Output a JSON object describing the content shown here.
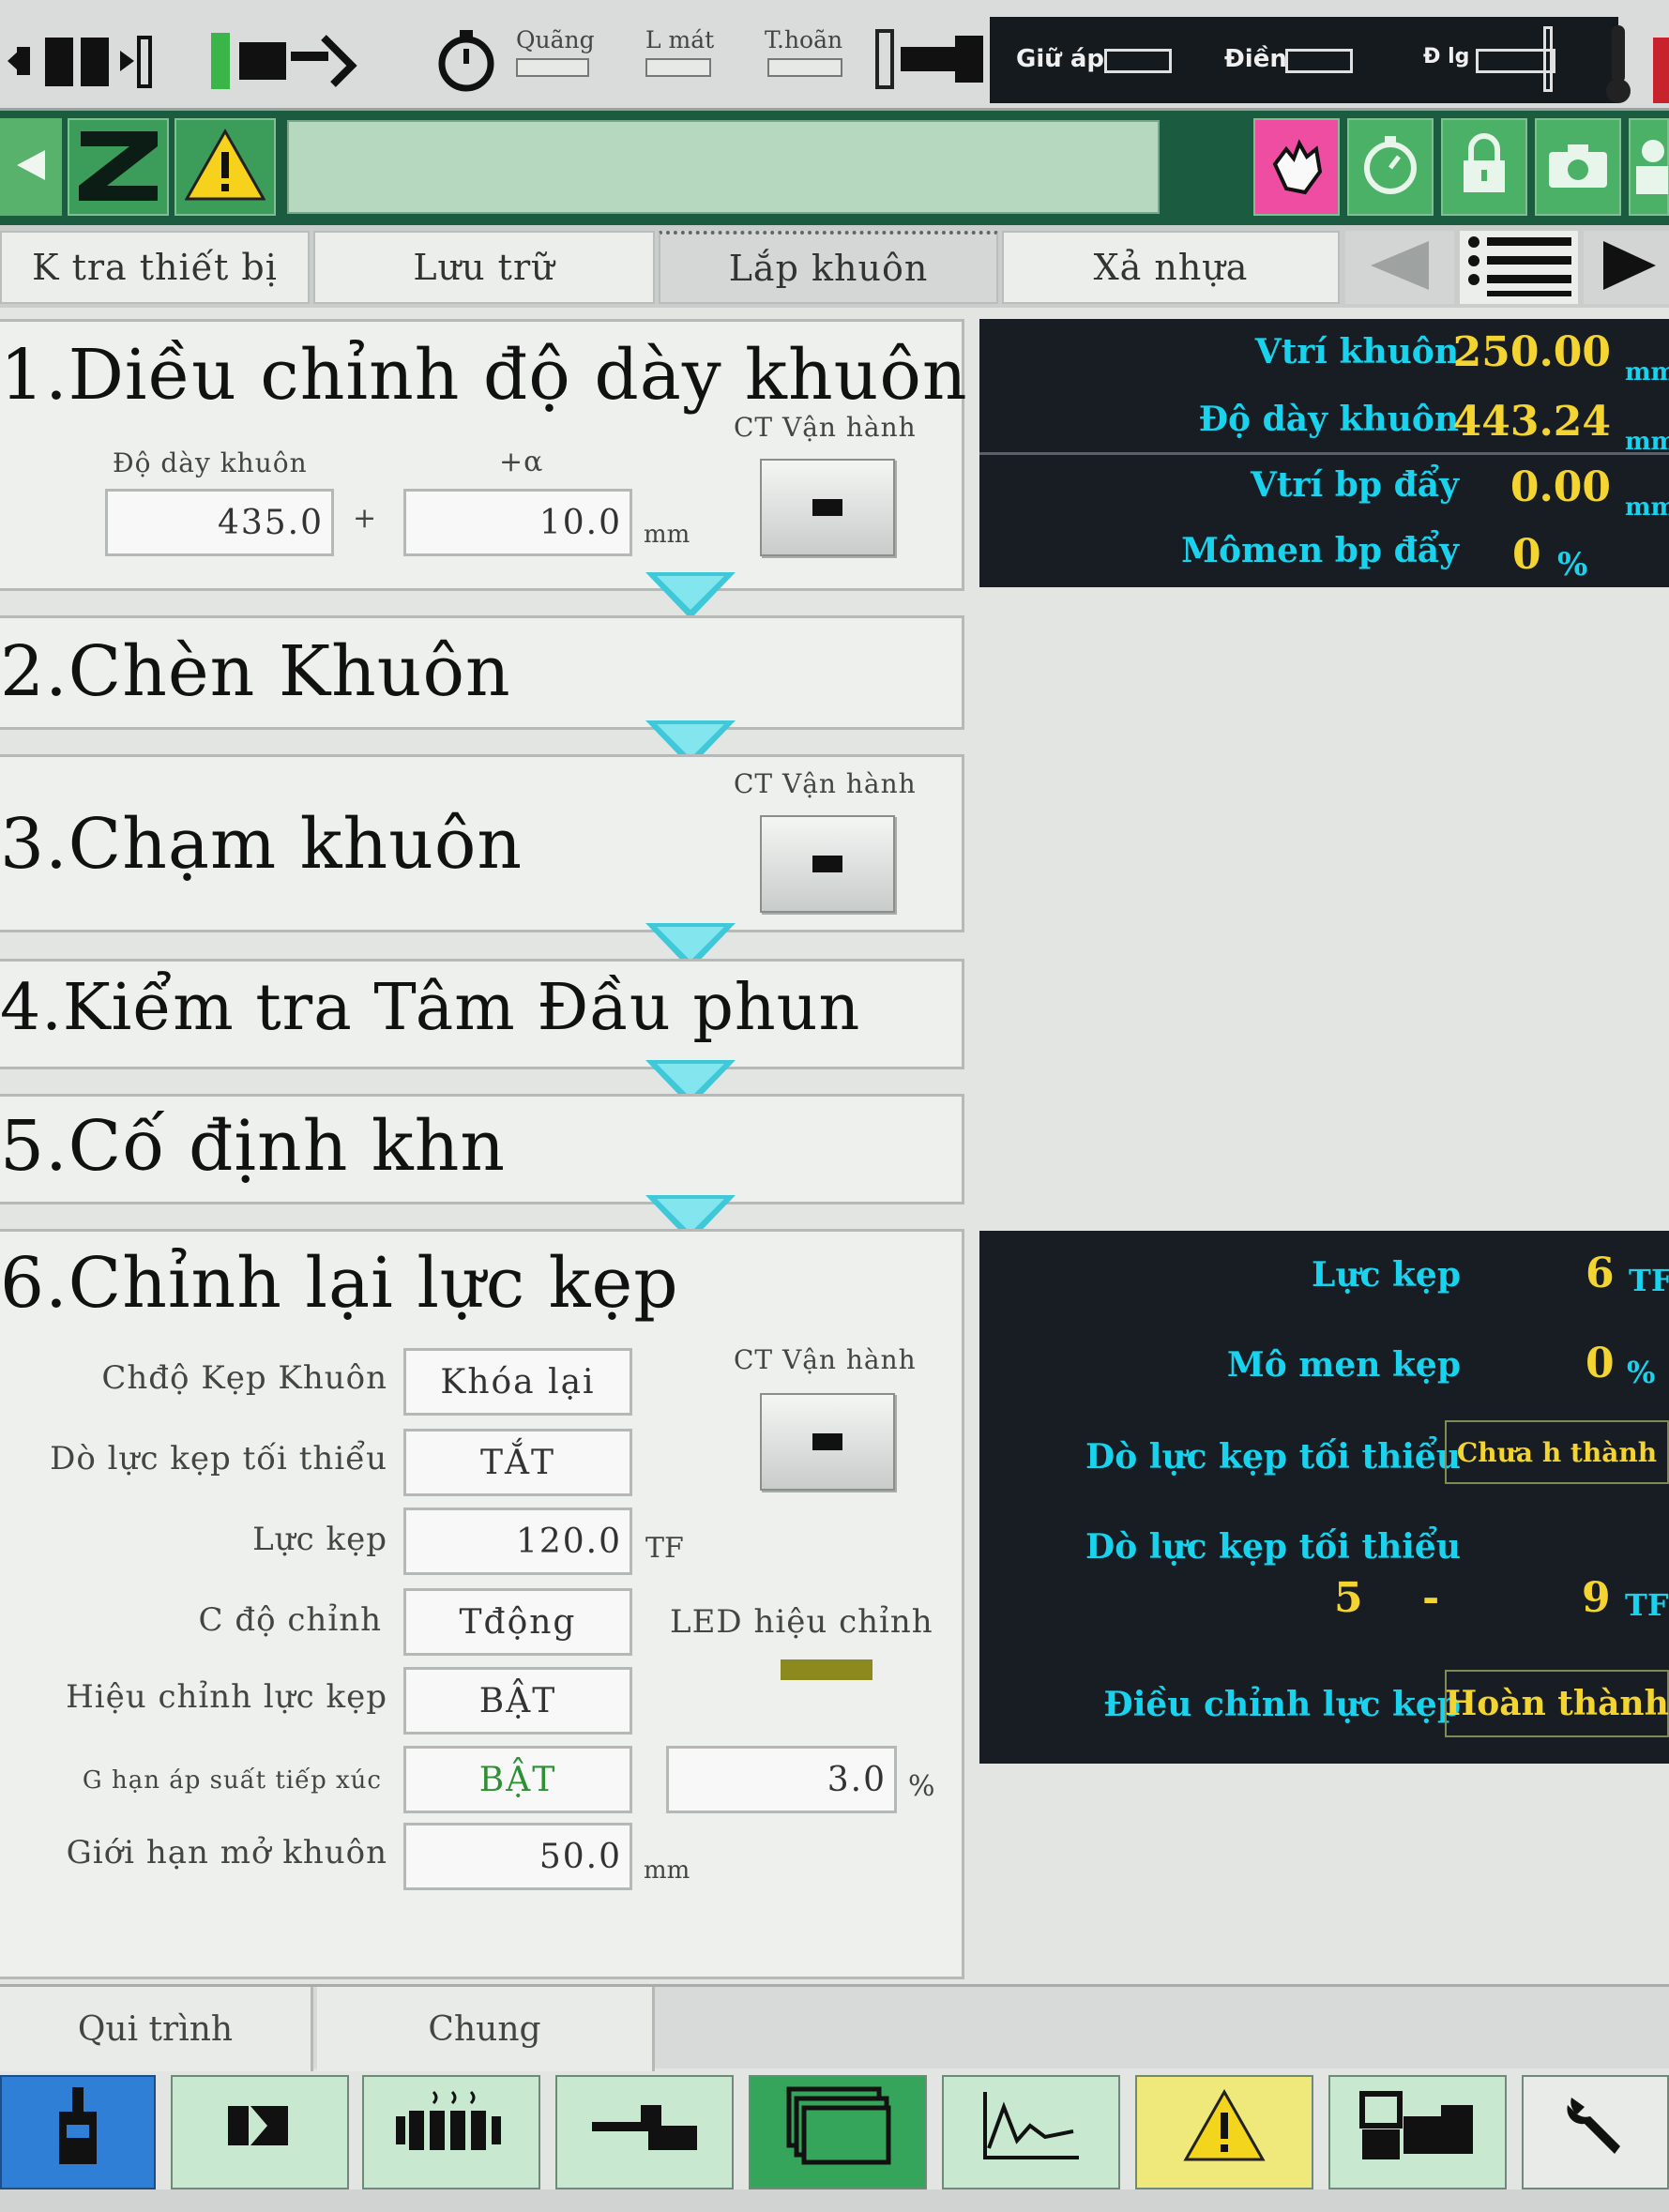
{
  "topbar": {
    "icons": [
      "mold-open-icon",
      "ejector-icon",
      "timer-icon"
    ],
    "labels": {
      "quang": "Quãng",
      "lmat": "L mát",
      "thoan": "T.hoãn"
    },
    "dark": {
      "giu_ap": "Giữ áp",
      "dien": "Điền",
      "dlg": "Đ lg"
    }
  },
  "bar2": {
    "icons": [
      "arrow-left-icon",
      "z-logo-icon",
      "warning-icon",
      "hand-icon",
      "stopwatch-icon",
      "lock-icon",
      "camera-icon",
      "user-icon"
    ]
  },
  "tabs": [
    "K tra thiết bị",
    "Lưu trữ",
    "Lắp khuôn",
    "Xả nhựa"
  ],
  "active_tab": "Lắp khuôn",
  "steps": {
    "s1": {
      "title": "1.Diều chỉnh độ dày khuôn",
      "ct_label": "CT Vận hành",
      "thick_label": "Độ dày khuôn",
      "alpha_label": "+α",
      "thick_value": "435.0",
      "plus": "+",
      "alpha_value": "10.0",
      "unit": "mm"
    },
    "s2": {
      "title": "2.Chèn Khuôn"
    },
    "s3": {
      "title": "3.Chạm khuôn",
      "ct_label": "CT Vận hành"
    },
    "s4": {
      "title": "4.Kiểm tra Tâm Đầu phun"
    },
    "s5": {
      "title": "5.Cố định khn"
    },
    "s6": {
      "title": "6.Chỉnh lại lực kẹp",
      "ct_label": "CT Vận hành",
      "rows": [
        {
          "label": "Chđộ Kẹp Khuôn",
          "value": "Khóa lại"
        },
        {
          "label": "Dò lực kẹp tối thiểu",
          "value": "TẮT"
        },
        {
          "label": "Lực kẹp",
          "value": "120.0",
          "unit": "TF"
        },
        {
          "label": "C độ chỉnh",
          "value": "Tđộng"
        },
        {
          "label": "Hiệu chỉnh lực kẹp",
          "value": "BẬT"
        },
        {
          "label": "G hạn áp suất tiếp xúc",
          "value": "BẬT",
          "extra_value": "3.0",
          "extra_unit": "%"
        },
        {
          "label": "Giới hạn mở khuôn",
          "value": "50.0",
          "unit": "mm"
        }
      ],
      "led_label": "LED hiệu chỉnh",
      "led_color": "#8c8a1e"
    }
  },
  "monitor_top": {
    "rows": [
      {
        "label": "Vtrí khuôn",
        "value": "250.00",
        "unit": "mm"
      },
      {
        "label": "Độ dày khuôn",
        "value": "443.24",
        "unit": "mm"
      },
      {
        "label": "Vtrí bp đẩy",
        "value": "0.00",
        "unit": "mm"
      },
      {
        "label": "Mômen bp đẩy",
        "value": "0",
        "unit": "%"
      }
    ]
  },
  "monitor_bottom": {
    "luc_kep_label": "Lực kẹp",
    "luc_kep_value": "6",
    "luc_kep_unit": "TF",
    "momen_label": "Mô men kẹp",
    "momen_value": "0",
    "momen_unit": "%",
    "do_luc_label": "Dò lực kẹp tối thiểu",
    "do_luc_status": "Chưa h thành",
    "range_label": "Dò lực kẹp tối thiểu",
    "range_min": "5",
    "range_dash": "-",
    "range_max": "9",
    "range_unit": "TF",
    "adjust_label": "Điều chỉnh lực kẹp",
    "adjust_status": "Hoàn thành"
  },
  "bottom_tabs": [
    "Qui trình",
    "Chung"
  ],
  "toolbar": [
    "injection-unit-icon",
    "mold-icon",
    "heater-icon",
    "ejector-tool-icon",
    "screens-icon",
    "trend-graph-icon",
    "alarm-icon",
    "machine-icon",
    "wrench-icon"
  ],
  "colors": {
    "accent_cyan": "#19d3ee",
    "value_yellow": "#f4d430",
    "bar_green": "#1b5b40",
    "arrow": "#3ec8d8"
  }
}
